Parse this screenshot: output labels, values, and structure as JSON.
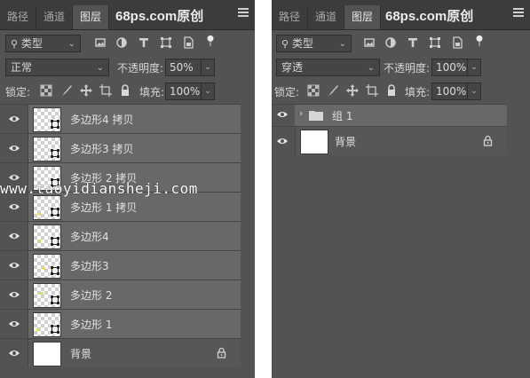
{
  "left_panel": {
    "tabs": [
      "路径",
      "通道",
      "图层"
    ],
    "brand": "68ps.com原创",
    "filter_label": "类型",
    "blend_mode": "正常",
    "opacity_label": "不透明度:",
    "opacity_value": "50%",
    "lock_label": "锁定:",
    "fill_label": "填充:",
    "fill_value": "100%",
    "layers": [
      {
        "name": "多边形4 拷贝",
        "type": "shape"
      },
      {
        "name": "多边形3 拷贝",
        "type": "shape"
      },
      {
        "name": "多边形 2 拷贝",
        "type": "shape"
      },
      {
        "name": "多边形 1 拷贝",
        "type": "shape"
      },
      {
        "name": "多边形4",
        "type": "shape"
      },
      {
        "name": "多边形3",
        "type": "shape"
      },
      {
        "name": "多边形 2",
        "type": "shape"
      },
      {
        "name": "多边形 1",
        "type": "shape"
      },
      {
        "name": "背景",
        "type": "background"
      }
    ]
  },
  "watermark": "www.taoyidiansheji.com",
  "right_panel": {
    "tabs": [
      "路径",
      "通道",
      "图层"
    ],
    "brand": "68ps.com原创",
    "filter_label": "类型",
    "blend_mode": "穿透",
    "opacity_label": "不透明度:",
    "opacity_value": "100%",
    "lock_label": "锁定:",
    "fill_label": "填充:",
    "fill_value": "100%",
    "group_name": "组 1",
    "background_name": "背景"
  },
  "colors": {
    "panel_bg": "#535353",
    "tab_bar_bg": "#3c3c3c",
    "selected_layer_bg": "#686868",
    "accent_dot": "#e8e13a"
  }
}
